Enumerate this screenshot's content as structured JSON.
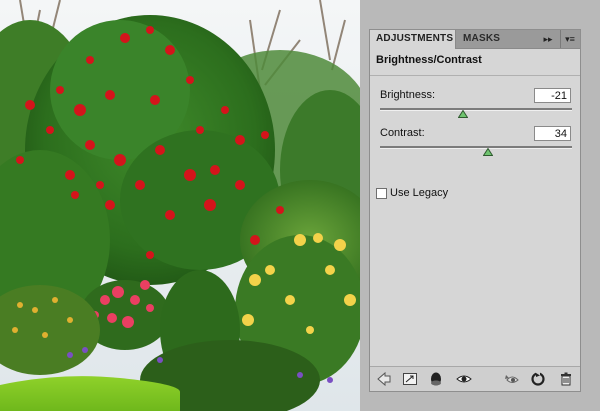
{
  "panel": {
    "tabs": [
      {
        "label": "ADJUSTMENTS",
        "active": true
      },
      {
        "label": "MASKS",
        "active": false
      }
    ],
    "forward_glyph": "▸▸",
    "menu_glyph": "▾≡",
    "title": "Brightness/Contrast",
    "controls": {
      "brightness": {
        "label": "Brightness:",
        "value": "-21",
        "range": [
          -150,
          150
        ]
      },
      "contrast": {
        "label": "Contrast:",
        "value": "34",
        "range": [
          -50,
          100
        ]
      }
    },
    "use_legacy": {
      "label": "Use Legacy",
      "checked": false
    },
    "bottom_icons": [
      "back-arrow-icon",
      "expand-view-icon",
      "clip-to-layer-icon",
      "visibility-eye-icon",
      "view-previous-state-icon",
      "reset-icon",
      "trash-icon"
    ]
  },
  "colors": {
    "panel_bg": "#d6d6d6",
    "app_bg": "#b9b9b9",
    "tab_bar": "#9a9a9a"
  }
}
